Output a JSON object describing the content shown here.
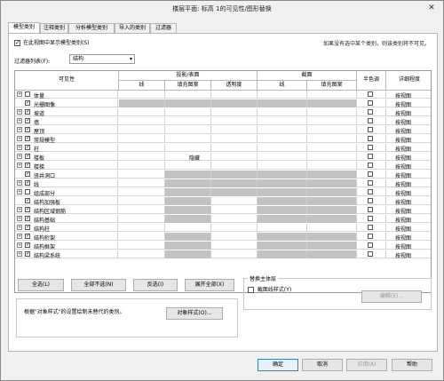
{
  "window": {
    "title": "楼层平面: 标高 1的可见性/图形替换",
    "close_glyph": "✕"
  },
  "tabs": [
    "模型类别",
    "注释类别",
    "分析模型类别",
    "导入的类别",
    "过滤器"
  ],
  "panel": {
    "show_label": "在此视图中显示模型类别(S)",
    "note": "如果没有选中某个类别，则该类别将不可见。",
    "filter_label": "过滤器列表(F):",
    "filter_value": "结构"
  },
  "grid": {
    "col_visibility": "可见性",
    "group_projection": "投影/表面",
    "group_cut": "截面",
    "col_line": "线",
    "col_fill": "填充图案",
    "col_transparency": "透明度",
    "col_cut_line": "线",
    "col_cut_fill": "填充图案",
    "col_halftone": "半色调",
    "col_detail": "详细程度",
    "rows": [
      {
        "name": "体量",
        "checked": false,
        "plus": true,
        "override": "",
        "detail": "按视图"
      },
      {
        "name": "光栅图像",
        "checked": true,
        "plus": false,
        "override": "",
        "detail": "按视图"
      },
      {
        "name": "坡道",
        "checked": true,
        "plus": true,
        "override": "",
        "detail": "按视图"
      },
      {
        "name": "墙",
        "checked": true,
        "plus": true,
        "override": "",
        "detail": "按视图"
      },
      {
        "name": "屋顶",
        "checked": true,
        "plus": true,
        "override": "",
        "detail": "按视图"
      },
      {
        "name": "常规模型",
        "checked": true,
        "plus": true,
        "override": "",
        "detail": "按视图"
      },
      {
        "name": "柱",
        "checked": true,
        "plus": true,
        "override": "",
        "detail": "按视图"
      },
      {
        "name": "楼板",
        "checked": true,
        "plus": true,
        "override": "隐藏",
        "detail": "按视图"
      },
      {
        "name": "楼梯",
        "checked": true,
        "plus": true,
        "override": "",
        "detail": "按视图"
      },
      {
        "name": "竖井洞口",
        "checked": true,
        "plus": false,
        "override": "",
        "detail": "按视图"
      },
      {
        "name": "线",
        "checked": true,
        "plus": true,
        "override": "",
        "detail": "按视图"
      },
      {
        "name": "组成部分",
        "checked": false,
        "plus": true,
        "override": "",
        "detail": "按视图"
      },
      {
        "name": "结构加强板",
        "checked": true,
        "plus": false,
        "override": "",
        "detail": "按视图"
      },
      {
        "name": "结构区域钢筋",
        "checked": true,
        "plus": true,
        "override": "",
        "detail": "按视图"
      },
      {
        "name": "结构基础",
        "checked": true,
        "plus": true,
        "override": "",
        "detail": "按视图"
      },
      {
        "name": "结构柱",
        "checked": true,
        "plus": true,
        "override": "",
        "detail": "按视图"
      },
      {
        "name": "结构桁架",
        "checked": true,
        "plus": true,
        "override": "",
        "detail": "按视图"
      },
      {
        "name": "结构框架",
        "checked": true,
        "plus": true,
        "override": "",
        "detail": "按视图"
      },
      {
        "name": "结构梁系统",
        "checked": true,
        "plus": true,
        "override": "",
        "detail": "按视图"
      }
    ]
  },
  "buttons": {
    "select_all": "全选(L)",
    "select_none": "全部不选(N)",
    "invert": "反选(I)",
    "expand_all": "展开全部(X)",
    "object_styles": "对象样式(O)...",
    "edit": "编辑(E)...",
    "ok": "确定",
    "cancel": "取消",
    "apply": "应用(A)",
    "help": "帮助"
  },
  "host": {
    "group_title": "替换主体层",
    "cut_style_label": "截面线样式(Y)",
    "cut_style_checked": false
  },
  "hint": "根据\"对象样式\"的设置绘制未替代的类别。"
}
